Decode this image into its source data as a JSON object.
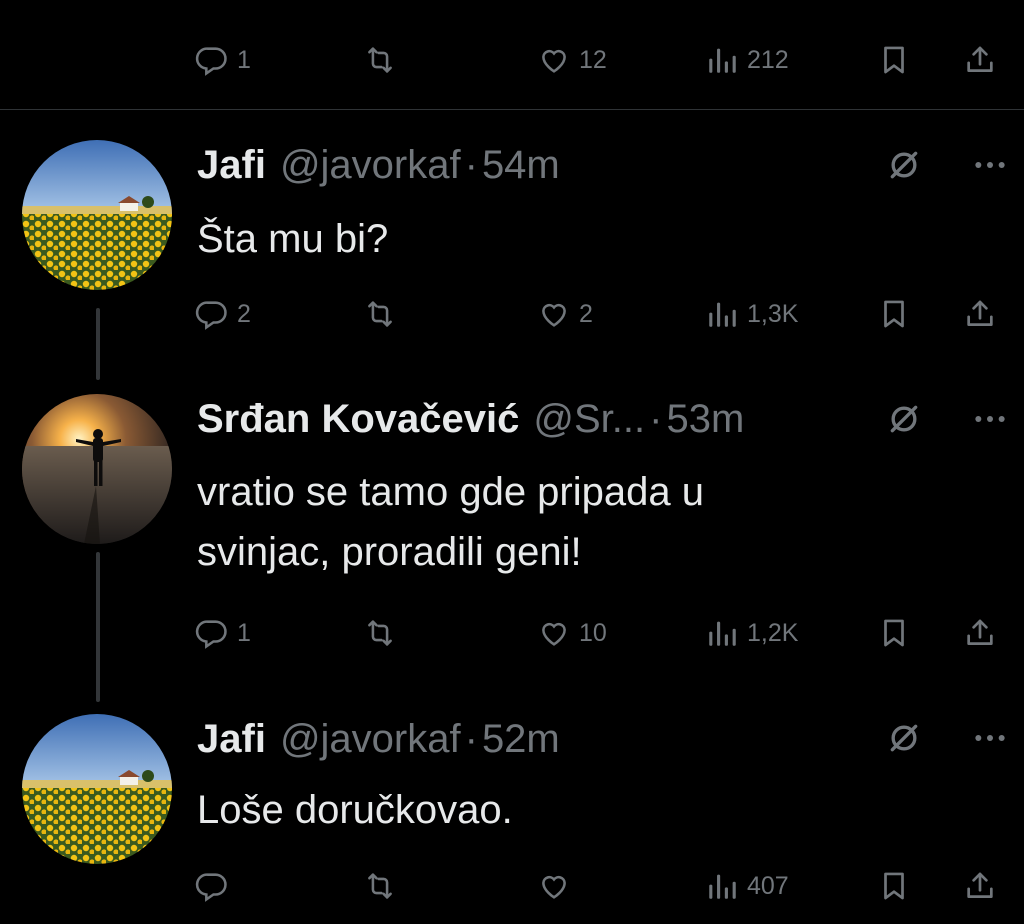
{
  "top_actions": {
    "replies": "1",
    "likes": "12",
    "views": "212"
  },
  "tweets": [
    {
      "name": "Jafi",
      "handle": "@javorkaf",
      "separator": "·",
      "time": "54m",
      "text_lines": [
        "Šta mu bi?"
      ],
      "replies": "2",
      "likes": "2",
      "views": "1,3K",
      "avatar": "sunflower-field-avatar"
    },
    {
      "name": "Srđan Kovačević",
      "handle": "@Sr...",
      "separator": "·",
      "time": "53m",
      "text_lines": [
        "vratio se tamo gde pripada u",
        "svinjac, proradili geni!"
      ],
      "replies": "1",
      "likes": "10",
      "views": "1,2K",
      "avatar": "sunset-silhouette-avatar"
    },
    {
      "name": "Jafi",
      "handle": "@javorkaf",
      "separator": "·",
      "time": "52m",
      "text_lines": [
        "Loše doručkovao."
      ],
      "replies": "",
      "likes": "",
      "views": "407",
      "avatar": "sunflower-field-avatar"
    }
  ],
  "colors": {
    "background": "#000000",
    "text": "#e7e9ea",
    "muted": "#71767b",
    "divider": "#2f3336",
    "thread_line": "#333639"
  }
}
